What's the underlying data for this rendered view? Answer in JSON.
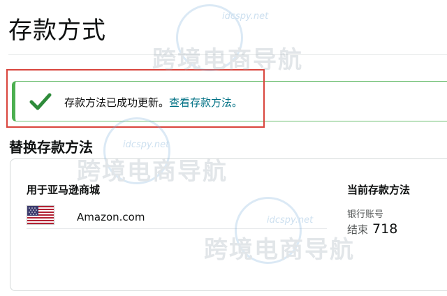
{
  "page": {
    "title": "存款方式"
  },
  "alert": {
    "message": "存款方法已成功更新。",
    "link_text": "查看存款方法。",
    "status_color": "#4caf50",
    "link_color": "#007185",
    "icon": "checkmark-icon"
  },
  "section": {
    "title": "替换存款方法"
  },
  "table": {
    "left_header": "用于亚马逊商城",
    "right_header": "当前存款方法",
    "rows": [
      {
        "flag": "us-flag-icon",
        "marketplace": "Amazon.com",
        "account_type": "银行账号",
        "ending_label": "结束",
        "ending_digits": "718"
      }
    ]
  },
  "watermark": {
    "url": "idcspy.net",
    "text": "跨境电商导航"
  },
  "colors": {
    "highlight_border": "#d9453d",
    "alert_border": "#6fbf73"
  }
}
